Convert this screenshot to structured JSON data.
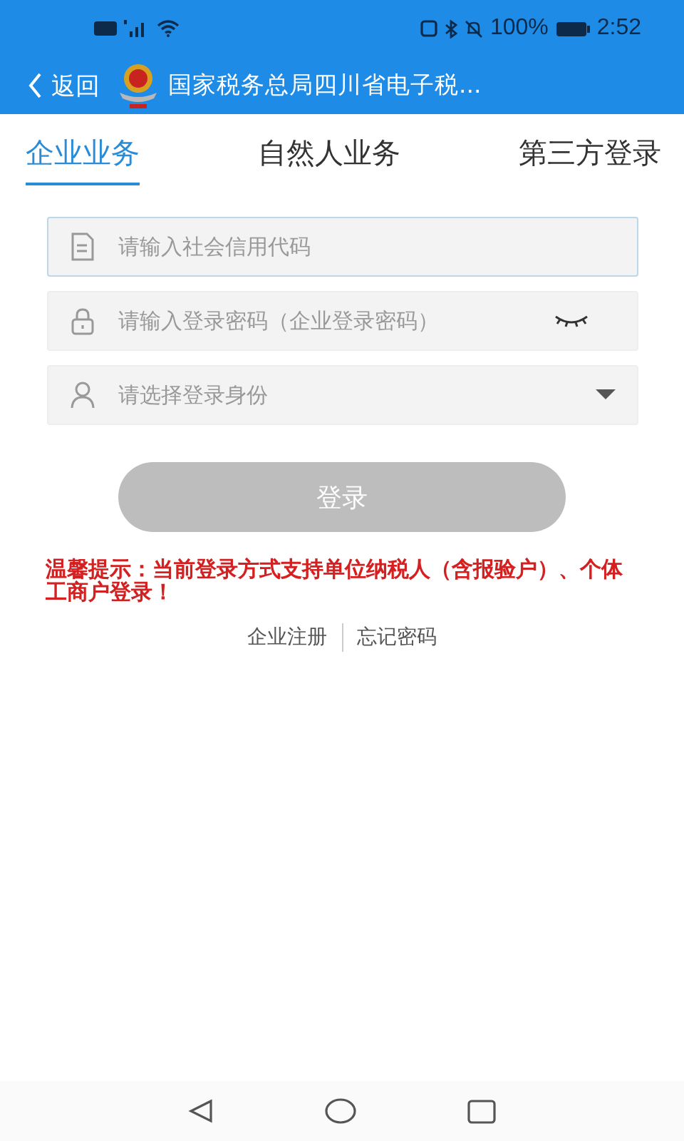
{
  "status_bar": {
    "battery_text": "100%",
    "time": "2:52"
  },
  "app_bar": {
    "back_label": "返回",
    "title": "国家税务总局四川省电子税..."
  },
  "tabs": [
    {
      "label": "企业业务",
      "selected": true
    },
    {
      "label": "自然人业务",
      "selected": false
    },
    {
      "label": "第三方登录",
      "selected": false
    }
  ],
  "fields": [
    {
      "kind": "text",
      "placeholder": "请输入社会信用代码",
      "focused": true
    },
    {
      "kind": "password",
      "placeholder": "请输入登录密码（企业登录密码）",
      "focused": false
    },
    {
      "kind": "select",
      "placeholder": "请选择登录身份",
      "focused": false
    }
  ],
  "login_button": {
    "label": "登录",
    "disabled": true
  },
  "notice": "温馨提示：当前登录方式支持单位纳税人（含报验户）、个体工商户登录！",
  "links": [
    "企业注册",
    "忘记密码"
  ]
}
